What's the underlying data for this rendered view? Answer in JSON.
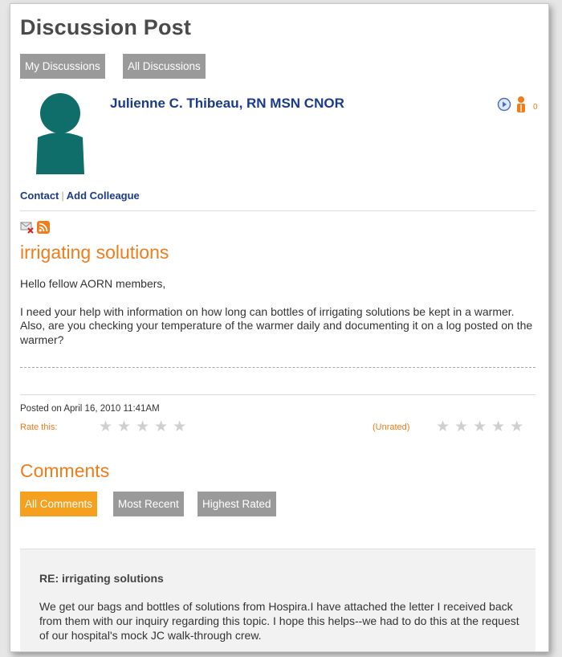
{
  "page": {
    "title": "Discussion Post"
  },
  "tabs": {
    "my_discussions": "My Discussions",
    "all_discussions": "All Discussions"
  },
  "author": {
    "name": "Julienne C. Thibeau, RN MSN CNOR",
    "status_count": "0",
    "links": {
      "contact": "Contact",
      "add_colleague": "Add Colleague"
    }
  },
  "post": {
    "title": "irrigating solutions",
    "greeting": "Hello fellow AORN members,",
    "body": "I need your help with information on how long can bottles of irrigating solutions be kept in a warmer. Also, are you checking your temperature of the warmer daily and documenting it on a log posted on the warmer?",
    "posted_on": "Posted on April 16, 2010 11:41AM",
    "rate_label": "Rate this:",
    "rating_status": "(Unrated)",
    "user_rating_stars": 0,
    "average_rating_stars": 0
  },
  "comments": {
    "heading": "Comments",
    "tabs": [
      "All Comments",
      "Most Recent",
      "Highest Rated"
    ],
    "active_tab": "All Comments",
    "items": [
      {
        "title": "RE: irrigating solutions",
        "text": "We get our bags and bottles of solutions from Hospira.I have attached the letter I received back from them with our inquiry regarding this topic. I hope this helps--we had to do this at the request of our hospital's mock JC walk-through crew."
      }
    ]
  },
  "colors": {
    "accent_orange": "#f07c1a",
    "active_tab": "#f5a01e",
    "inactive_tab": "#9a9a9a",
    "link_blue": "#1a3a8c",
    "avatar_teal": "#0f6e6a"
  },
  "icons": {
    "status": [
      "online-status-icon",
      "person-icon"
    ],
    "post_tools": [
      "unsubscribe-email-icon",
      "rss-feed-icon"
    ]
  }
}
